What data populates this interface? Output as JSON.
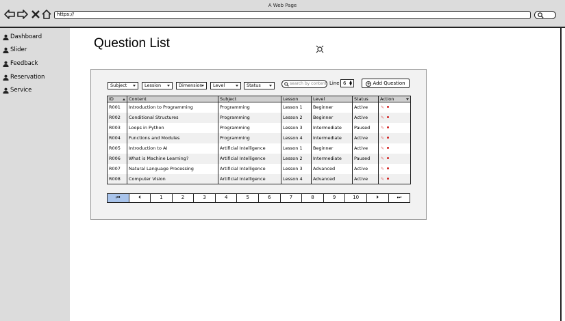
{
  "window": {
    "title": "A Web Page",
    "url": "https://"
  },
  "sidebar": {
    "items": [
      {
        "label": "Dashboard"
      },
      {
        "label": "Slider"
      },
      {
        "label": "Feedback"
      },
      {
        "label": "Reservation"
      },
      {
        "label": "Service"
      }
    ]
  },
  "page": {
    "title": "Question List"
  },
  "filters": {
    "subject": "Subject",
    "lesson": "Lession",
    "dimension": "Dimension",
    "level": "Level",
    "status": "Status",
    "search_placeholder": "search by content",
    "line_label": "Line",
    "line_value": "6",
    "add_label": "Add Question"
  },
  "table": {
    "headers": {
      "id": "ID",
      "content": "Content",
      "subject": "Subject",
      "lesson": "Lesson",
      "level": "Level",
      "status": "Status",
      "action": "Action"
    },
    "rows": [
      {
        "id": "R001",
        "content": "Introduction to Programming",
        "subject": "Programming",
        "lesson": "Lesson 1",
        "level": "Beginner",
        "status": "Active"
      },
      {
        "id": "R002",
        "content": "Conditional Structures",
        "subject": "Programming",
        "lesson": "Lesson 2",
        "level": "Beginner",
        "status": "Active"
      },
      {
        "id": "R003",
        "content": "Loops in Python",
        "subject": "Programming",
        "lesson": "Lesson 3",
        "level": "Intermediate",
        "status": "Paused"
      },
      {
        "id": "R004",
        "content": "Functions and Modules",
        "subject": "Programming",
        "lesson": "Lesson 4",
        "level": "Intermediate",
        "status": "Active"
      },
      {
        "id": "R005",
        "content": "Introduction to AI",
        "subject": "Artificial Intelligence",
        "lesson": "Lesson 1",
        "level": "Beginner",
        "status": "Active"
      },
      {
        "id": "R006",
        "content": "What is Machine Learning?",
        "subject": "Artificial Intelligence",
        "lesson": "Lesson 2",
        "level": "Intermediate",
        "status": "Paused"
      },
      {
        "id": "R007",
        "content": "Natural Language Processing",
        "subject": "Artificial Intelligence",
        "lesson": "Lesson 3",
        "level": "Advanced",
        "status": "Active"
      },
      {
        "id": "R008",
        "content": "Computer Vision",
        "subject": "Artificial Intelligence",
        "lesson": "Lesson 4",
        "level": "Advanced",
        "status": "Active"
      }
    ]
  },
  "pagination": {
    "first": "⏮",
    "prev": "⏴",
    "next": "⏵",
    "last": "⏭",
    "pages": [
      "1",
      "2",
      "3",
      "4",
      "5",
      "6",
      "7",
      "8",
      "9",
      "10"
    ]
  },
  "colors": {
    "sidebar_bg": "#dcdcdc",
    "header_bg": "#cfcfcf",
    "active_page": "#a9c4eb",
    "delete_icon": "#d02020"
  }
}
